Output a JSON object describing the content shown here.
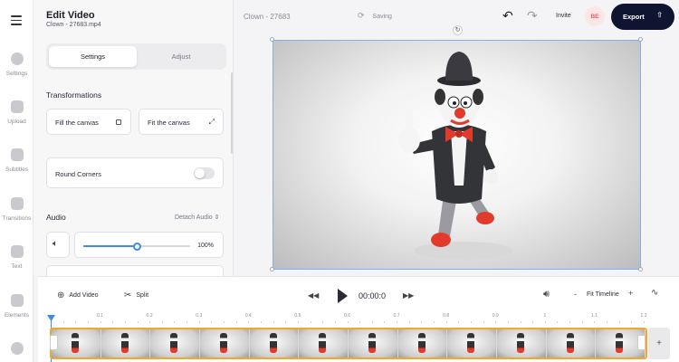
{
  "rail": {
    "items": [
      {
        "label": "Settings",
        "icon": "gear-icon"
      },
      {
        "label": "Upload",
        "icon": "plus-icon"
      },
      {
        "label": "Subtitles",
        "icon": "subtitles-icon"
      },
      {
        "label": "Transitions",
        "icon": "transitions-icon"
      },
      {
        "label": "Text",
        "icon": "text-icon"
      },
      {
        "label": "Elements",
        "icon": "elements-icon"
      }
    ]
  },
  "panel": {
    "title": "Edit Video",
    "filename": "Clown - 27683.mp4",
    "tabs": {
      "settings": "Settings",
      "adjust": "Adjust"
    },
    "transformations_title": "Transformations",
    "fill_canvas": "Fill the canvas",
    "fit_canvas": "Fit the canvas",
    "round_corners": "Round Corners",
    "audio_title": "Audio",
    "detach_audio": "Detach Audio",
    "volume_value": "100%",
    "volume_fraction": 0.5
  },
  "topbar": {
    "project_name": "Clown - 27683",
    "saving": "Saving",
    "invite": "Invite",
    "avatar": "BE",
    "export": "Export"
  },
  "timeline": {
    "add_video": "Add Video",
    "split": "Split",
    "time": "00:00:0",
    "fit_timeline": "Fit Timeline",
    "ruler_ticks": [
      "0.1",
      "0.2",
      "0.3",
      "0.4",
      "0.5",
      "0.6",
      "0.7",
      "0.8",
      "0.9",
      "1",
      "1.1",
      "1.2"
    ]
  },
  "colors": {
    "accent": "#3a8de0",
    "export_bg": "#0f1530",
    "track_border": "#f0a92c"
  }
}
